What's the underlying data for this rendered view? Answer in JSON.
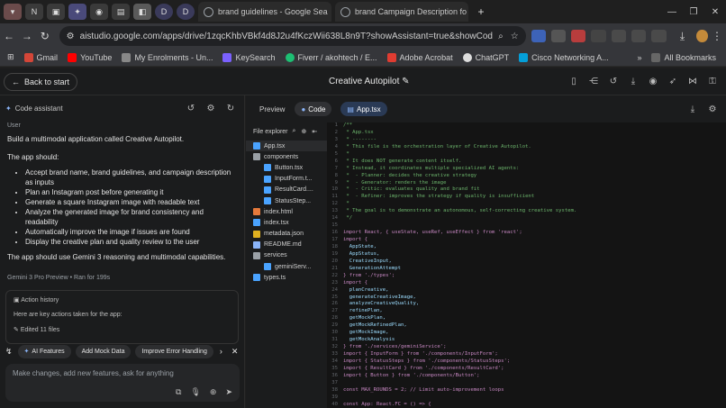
{
  "browser": {
    "tabs": [
      {
        "label": "brand guidelines - Google Sea",
        "active": false
      },
      {
        "label": "brand Campaign Description fo",
        "active": false
      }
    ],
    "pinned_tabs": [
      "N",
      "D",
      "D"
    ],
    "address": "aistudio.google.com/apps/drive/1zqcKhbVBkf4d8J2u4fKczWii638L8n9T?showAssistant=true&showCode=true",
    "bookmarks": [
      "Gmail",
      "YouTube",
      "My Enrolments - Un...",
      "KeySearch",
      "Fiverr / akohtech / E...",
      "Adobe Acrobat",
      "ChatGPT",
      "Cisco Networking A..."
    ],
    "all_bookmarks": "All Bookmarks"
  },
  "app": {
    "back_label": "Back to start",
    "title": "Creative Autopilot",
    "assistant_label": "Code assistant"
  },
  "chat": {
    "user_label": "User",
    "intro": "Build a multimodal application called Creative Autopilot.",
    "subhead": "The app should:",
    "bullets": [
      "Accept brand name, brand guidelines, and campaign description as inputs",
      "Plan an Instagram post before generating it",
      "Generate a square Instagram image with readable text",
      "Analyze the generated image for brand consistency and readability",
      "Automatically improve the image if issues are found",
      "Display the creative plan and quality review to the user"
    ],
    "closing": "The app should use Gemini 3 reasoning and multimodal capabilities.",
    "model_line": "Gemini 3 Pro Preview",
    "ran_for": "Ran for 199s",
    "history_title": "Action history",
    "history_text": "Here are key actions taken for the app:",
    "edited": "Edited 11 files",
    "chips": [
      "AI Features",
      "Add Mock Data",
      "Improve Error Handling"
    ],
    "placeholder": "Make changes, add new features, ask for anything"
  },
  "code_panel": {
    "tabs": [
      "Preview",
      "Code"
    ],
    "active_file": "App.tsx",
    "explorer_title": "File explorer",
    "files": [
      {
        "name": "App.tsx",
        "indent": 0,
        "type": "tsx",
        "selected": true
      },
      {
        "name": "components",
        "indent": 0,
        "type": "folder"
      },
      {
        "name": "Button.tsx",
        "indent": 1,
        "type": "tsx"
      },
      {
        "name": "InputForm.t...",
        "indent": 1,
        "type": "tsx"
      },
      {
        "name": "ResultCard....",
        "indent": 1,
        "type": "tsx"
      },
      {
        "name": "StatusStep...",
        "indent": 1,
        "type": "tsx"
      },
      {
        "name": "index.html",
        "indent": 0,
        "type": "html"
      },
      {
        "name": "index.tsx",
        "indent": 0,
        "type": "tsx"
      },
      {
        "name": "metadata.json",
        "indent": 0,
        "type": "json"
      },
      {
        "name": "README.md",
        "indent": 0,
        "type": "md"
      },
      {
        "name": "services",
        "indent": 0,
        "type": "folder"
      },
      {
        "name": "geminiServ...",
        "indent": 1,
        "type": "ts"
      },
      {
        "name": "types.ts",
        "indent": 0,
        "type": "ts"
      }
    ],
    "code_lines": [
      "/**",
      " * App.tsx",
      " * --------",
      " * This file is the orchestration layer of Creative Autopilot.",
      " *",
      " * It does NOT generate content itself.",
      " * Instead, it coordinates multiple specialized AI agents:",
      " *  - Planner: decides the creative strategy",
      " *  - Generator: renders the image",
      " *  - Critic: evaluates quality and brand fit",
      " *  - Refiner: improves the strategy if quality is insufficient",
      " *",
      " * The goal is to demonstrate an autonomous, self-correcting creative system.",
      " */",
      "",
      "import React, { useState, useRef, useEffect } from 'react';",
      "import {",
      "  AppState,",
      "  AppStatus,",
      "  CreativeInput,",
      "  GenerationAttempt",
      "} from './types';",
      "import {",
      "  planCreative,",
      "  generateCreativeImage,",
      "  analyzeCreativeQuality,",
      "  refinePlan,",
      "  getMockPlan,",
      "  getMockRefinedPlan,",
      "  getMockImage,",
      "  getMockAnalysis",
      "} from './services/geminiService';",
      "import { InputForm } from './components/InputForm';",
      "import { StatusSteps } from './components/StatusSteps';",
      "import { ResultCard } from './components/ResultCard';",
      "import { Button } from './components/Button';",
      "",
      "const MAX_ROUNDS = 2; // Limit auto-improvement loops",
      "",
      "const App: React.FC = () => {"
    ]
  },
  "colors": {
    "accent": "#8ab4f8",
    "background": "#1b1c1d"
  }
}
